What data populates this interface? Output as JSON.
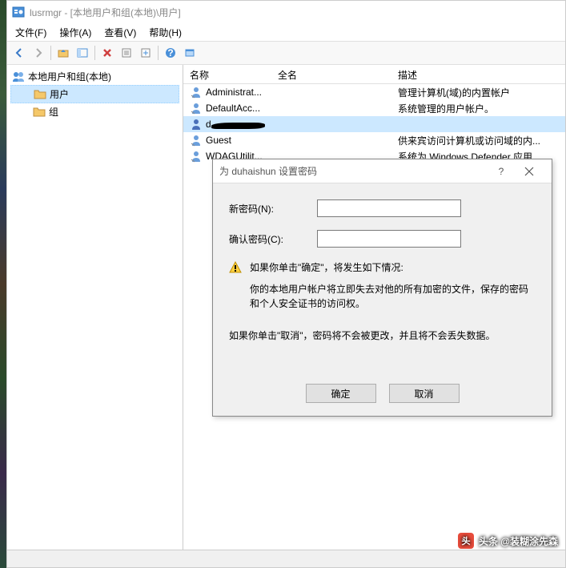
{
  "title": "lusrmgr - [本地用户和组(本地)\\用户]",
  "menu": {
    "file": "文件(F)",
    "action": "操作(A)",
    "view": "查看(V)",
    "help": "帮助(H)"
  },
  "tree": {
    "root": "本地用户和组(本地)",
    "users": "用户",
    "groups": "组"
  },
  "list": {
    "headers": {
      "name": "名称",
      "fullname": "全名",
      "description": "描述"
    },
    "rows": [
      {
        "name": "Administrat...",
        "fullname": "",
        "description": "管理计算机(域)的内置帐户"
      },
      {
        "name": "DefaultAcc...",
        "fullname": "",
        "description": "系统管理的用户帐户。"
      },
      {
        "name": "d",
        "fullname": "",
        "description": ""
      },
      {
        "name": "Guest",
        "fullname": "",
        "description": "供来宾访问计算机或访问域的内..."
      },
      {
        "name": "WDAGUtilit...",
        "fullname": "",
        "description": "系统为 Windows Defender 应用..."
      }
    ]
  },
  "dialog": {
    "title": "为 duhaishun 设置密码",
    "new_password_label": "新密码(N):",
    "confirm_password_label": "确认密码(C):",
    "new_password_value": "",
    "confirm_password_value": "",
    "warning_text": "如果你单击\"确定\"，将发生如下情况:",
    "info1": "你的本地用户帐户将立即失去对他的所有加密的文件，保存的密码和个人安全证书的访问权。",
    "info2": "如果你单击\"取消\"，密码将不会被更改，并且将不会丢失数据。",
    "ok_button": "确定",
    "cancel_button": "取消"
  },
  "footer": {
    "badge": "头",
    "text": "头条 @装糊涂先森"
  }
}
